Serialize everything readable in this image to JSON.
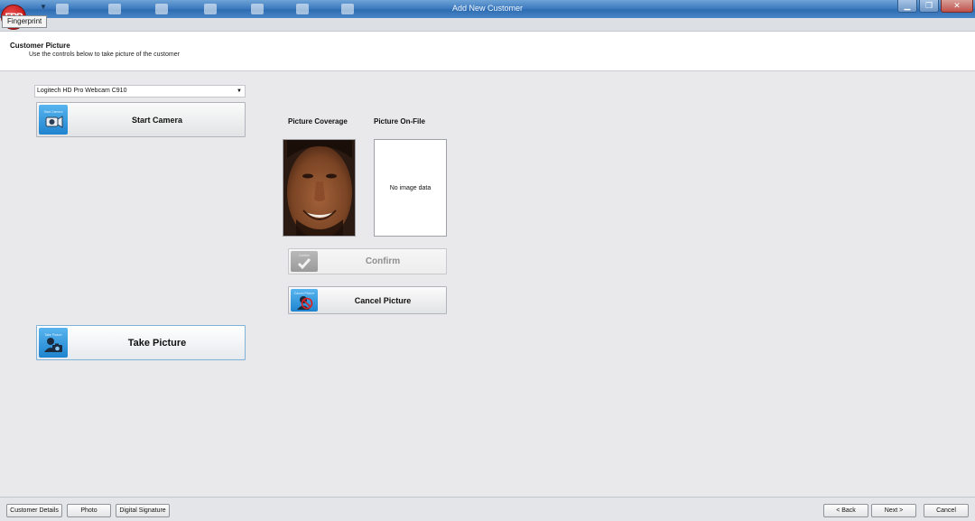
{
  "window": {
    "title": "Add New Customer",
    "app_logo": "FRP"
  },
  "ribbon": {
    "tab": "Fingerprint"
  },
  "header": {
    "title": "Customer Picture",
    "subtitle": "Use the controls below to take picture of the customer"
  },
  "camera": {
    "selected": "Logitech HD Pro Webcam C910",
    "start_label": "Start Camera",
    "take_label": "Take Picture",
    "start_icon_caption": "Start Camera",
    "take_icon_caption": "Take Picture"
  },
  "pictures": {
    "coverage_label": "Picture Coverage",
    "onfile_label": "Picture On-File",
    "onfile_placeholder": "No image data"
  },
  "actions": {
    "confirm_label": "Confirm",
    "confirm_icon_caption": "Confirm",
    "cancel_label": "Cancel Picture",
    "cancel_icon_caption": "Cancel Picture"
  },
  "footer": {
    "customer_details": "Customer Details",
    "photo": "Photo",
    "digital_signature": "Digital Signature",
    "back": "< Back",
    "next": "Next >",
    "cancel": "Cancel"
  },
  "colors": {
    "titlebar": "#3f7cc0",
    "icon_blue": "#1f84cf",
    "logo_red": "#c91d1d"
  }
}
